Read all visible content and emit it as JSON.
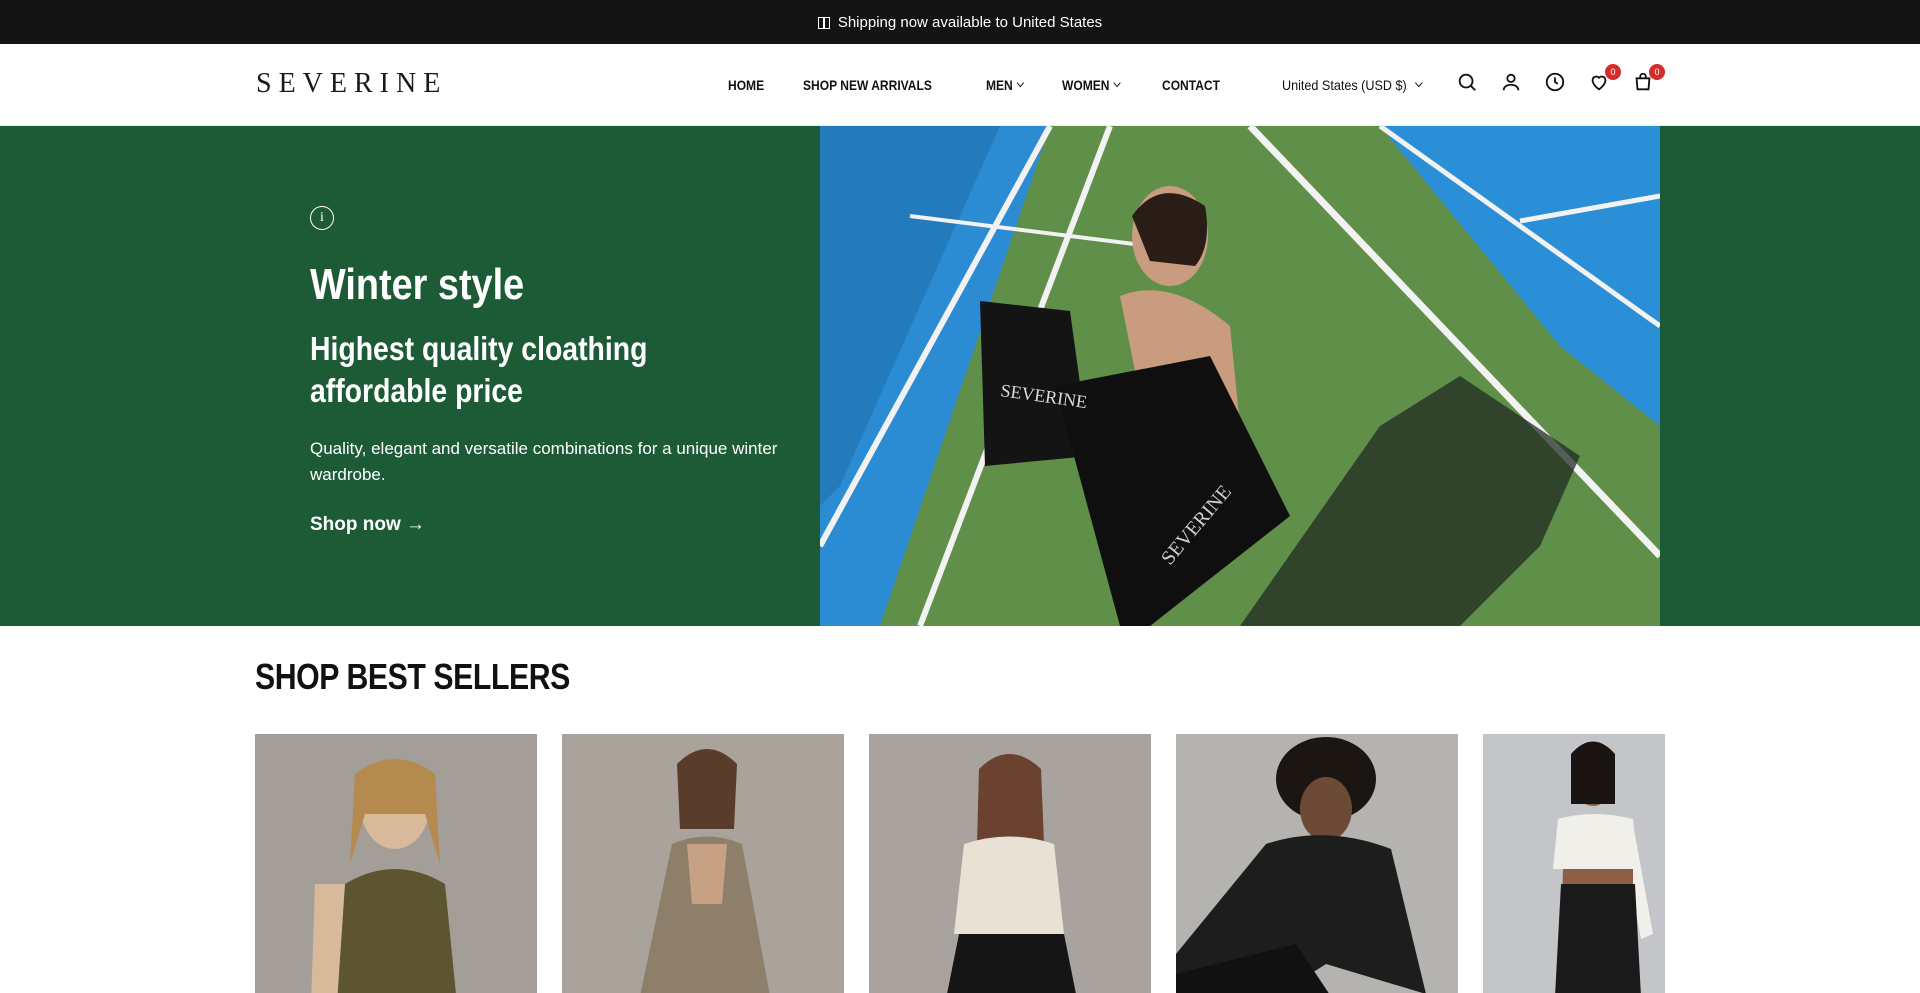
{
  "announcement": {
    "flag_icon": "us-flag-icon",
    "text": "Shipping now available to United States"
  },
  "header": {
    "logo": "SEVERINE",
    "nav": [
      {
        "label": "HOME",
        "has_dropdown": false
      },
      {
        "label": "SHOP NEW ARRIVALS",
        "has_dropdown": false
      },
      {
        "label": "MEN",
        "has_dropdown": true
      },
      {
        "label": "WOMEN",
        "has_dropdown": true
      },
      {
        "label": "CONTACT",
        "has_dropdown": false
      }
    ],
    "currency": "United States (USD $)",
    "icons": [
      "search-icon",
      "account-icon",
      "recently-viewed-icon",
      "wishlist-icon",
      "cart-icon"
    ],
    "wishlist_count": "0",
    "cart_count": "0"
  },
  "hero": {
    "info_glyph": "i",
    "title": "Winter style",
    "subtitle": "Highest quality cloathing affordable price",
    "description": "Quality, elegant and versatile combinations for a unique winter wardrobe.",
    "cta": "Shop now →",
    "background_color": "#1d5b37",
    "bag_text": "SEVERINE"
  },
  "best_sellers": {
    "title": "SHOP BEST SELLERS"
  }
}
